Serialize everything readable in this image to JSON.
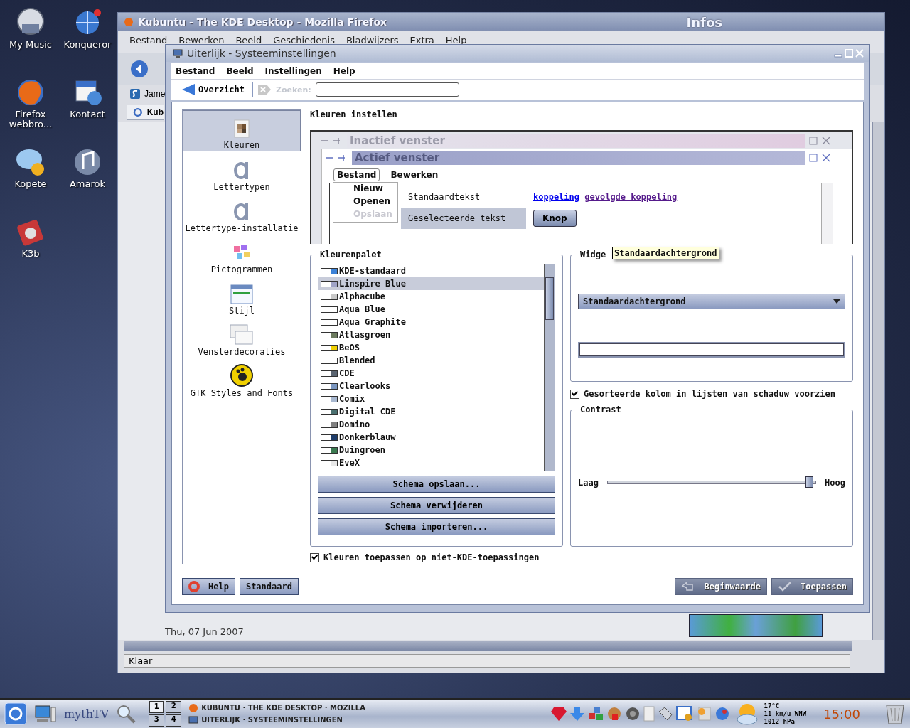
{
  "desktop_icons": [
    {
      "label": "My Music",
      "kind": "music"
    },
    {
      "label": "Konqueror",
      "kind": "globe"
    },
    {
      "label": "Firefox webbro...",
      "kind": "firefox"
    },
    {
      "label": "Kontact",
      "kind": "calendar"
    },
    {
      "label": "Kopete",
      "kind": "chat"
    },
    {
      "label": "Amarok",
      "kind": "audio"
    },
    {
      "label": "K3b",
      "kind": "disc"
    }
  ],
  "browser_window": {
    "title": "Kubuntu - The KDE Desktop - Mozilla Firefox",
    "menu": [
      "Bestand",
      "Bewerken",
      "Beeld",
      "Geschiedenis",
      "Bladwijzers",
      "Extra",
      "Help"
    ],
    "bookmark": "Jame",
    "tab": "Kub",
    "widget_text": "Infos",
    "date": "Thu, 07 Jun 2007",
    "status": "Klaar"
  },
  "dialog": {
    "title": "Uiterlijk - Systeeminstellingen",
    "menu": [
      "Bestand",
      "Beeld",
      "Instellingen",
      "Help"
    ],
    "overview_button": "Overzicht",
    "search_label": "Zoeken:",
    "sidebar": [
      {
        "label": "Kleuren",
        "kind": "colors",
        "selected": true
      },
      {
        "label": "Lettertypen",
        "kind": "font",
        "selected": false
      },
      {
        "label": "Lettertype-installatie",
        "kind": "font",
        "selected": false
      },
      {
        "label": "Pictogrammen",
        "kind": "icons",
        "selected": false
      },
      {
        "label": "Stijl",
        "kind": "style",
        "selected": false
      },
      {
        "label": "Vensterdecoraties",
        "kind": "windows",
        "selected": false
      },
      {
        "label": "GTK Styles and Fonts",
        "kind": "gtk",
        "selected": false
      }
    ],
    "heading": "Kleuren instellen",
    "preview": {
      "inactive_title": "Inactief venster",
      "active_title": "Actief venster",
      "menu": [
        {
          "label": "Bestand",
          "selected": true
        },
        {
          "label": "Bewerken",
          "selected": false
        }
      ],
      "popup": [
        {
          "label": "Nieuw",
          "disabled": false
        },
        {
          "label": "Openen",
          "disabled": false
        },
        {
          "label": "Opslaan",
          "disabled": true
        }
      ],
      "normal_text": "Standaardtekst",
      "selected_text": "Geselecteerde tekst",
      "link": "koppeling",
      "visited_link": "gevolgde koppeling",
      "button": "Knop"
    },
    "palette": {
      "legend": "Kleurenpalet",
      "schemes": [
        {
          "name": "KDE-standaard",
          "color": "#3c82d8",
          "selected": false
        },
        {
          "name": "Linspire Blue",
          "color": "#a0a4c8",
          "selected": true
        },
        {
          "name": "Alphacube",
          "color": "#c8c8c8",
          "selected": false
        },
        {
          "name": "Aqua Blue",
          "color": "#ffffff",
          "selected": false
        },
        {
          "name": "Aqua Graphite",
          "color": "#ffffff",
          "selected": false
        },
        {
          "name": "Atlasgroen",
          "color": "#6b7a5e",
          "selected": false
        },
        {
          "name": "BeOS",
          "color": "#f0d000",
          "selected": false
        },
        {
          "name": "Blended",
          "color": "#ffffff",
          "selected": false
        },
        {
          "name": "CDE",
          "color": "#5a6470",
          "selected": false
        },
        {
          "name": "Clearlooks",
          "color": "#7a96c0",
          "selected": false
        },
        {
          "name": "Comix",
          "color": "#a8b8d0",
          "selected": false
        },
        {
          "name": "Digital CDE",
          "color": "#4a7070",
          "selected": false
        },
        {
          "name": "Domino",
          "color": "#808080",
          "selected": false
        },
        {
          "name": "Donkerblauw",
          "color": "#1e3c6a",
          "selected": false
        },
        {
          "name": "Duingroen",
          "color": "#3a7a50",
          "selected": false
        },
        {
          "name": "EveX",
          "color": "#e8e8e8",
          "selected": false
        }
      ],
      "buttons": [
        "Schema opslaan...",
        "Schema verwijderen",
        "Schema importeren..."
      ]
    },
    "widget_color": {
      "legend": "Widge",
      "tooltip": "Standaardachtergrond",
      "dropdown": "Standaardachtergrond"
    },
    "shade_sorted": {
      "label": "Gesorteerde kolom in lijsten van schaduw voorzien",
      "checked": true
    },
    "contrast": {
      "legend": "Contrast",
      "low": "Laag",
      "high": "Hoog",
      "level": 0.97
    },
    "apply_non_kde": {
      "label": "Kleuren toepassen op niet-KDE-toepassingen",
      "checked": true
    },
    "footer_buttons": [
      {
        "label": "Help",
        "kind": "help",
        "disabled": false
      },
      {
        "label": "Standaard",
        "kind": "plain",
        "disabled": false
      },
      {
        "label": "Beginwaarde",
        "kind": "undo",
        "disabled": true
      },
      {
        "label": "Toepassen",
        "kind": "apply",
        "disabled": true
      }
    ]
  },
  "taskbar": {
    "logo_text": "mythTV",
    "pager": [
      {
        "label": "1",
        "selected": true
      },
      {
        "label": "2",
        "selected": false
      },
      {
        "label": "3",
        "selected": false
      },
      {
        "label": "4",
        "selected": false
      }
    ],
    "tasks": [
      {
        "label": "KUBUNTU · THE KDE DESKTOP · MOZILLA"
      },
      {
        "label": "UITERLIJK · SYSTEEMINSTELLINGEN"
      }
    ],
    "weather": [
      "17°C",
      "11 km/u WNW",
      "1012 hPa"
    ],
    "clock": "15:00"
  }
}
